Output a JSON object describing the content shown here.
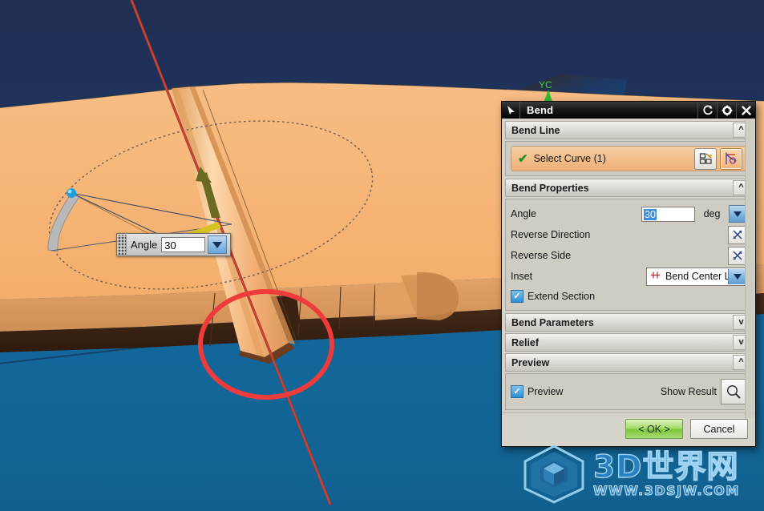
{
  "viewport": {
    "name": "3d-modeling-viewport",
    "background_top_color": "#1e2a4d",
    "background_bottom_color": "#14679c",
    "part_color": "#f5b473",
    "bend_line_color": "#c0392b",
    "annotation_circle_color": "#ee3b3b",
    "triad_label": "YC",
    "triad_label_color": "#2fc02f"
  },
  "angle_float": {
    "label": "Angle",
    "value": "30",
    "placeholder": "30",
    "spin_icon": "chevron-down-icon",
    "grip_icon": "drag-handle-icon"
  },
  "dialog": {
    "title": "Bend",
    "titlebar_icons": {
      "cursor": "cursor-arrow-icon",
      "reset": "reset-arrow-icon",
      "settings": "gear-icon",
      "close": "close-x-icon"
    },
    "sections": [
      {
        "label": "Bend Line",
        "state": "expanded",
        "chevron": "^"
      },
      {
        "label": "Bend Properties",
        "state": "expanded",
        "chevron": "^"
      },
      {
        "label": "Bend Parameters",
        "state": "collapsed",
        "chevron": "v"
      },
      {
        "label": "Relief",
        "state": "collapsed",
        "chevron": "v"
      },
      {
        "label": "Preview",
        "state": "expanded",
        "chevron": "^"
      }
    ],
    "bend_line": {
      "select_curve_label": "Select Curve (1)",
      "status_icon": "green-check-icon",
      "buttons": [
        {
          "icon": "curve-rule-icon",
          "active": false
        },
        {
          "icon": "sketch-curve-icon",
          "active": true
        }
      ]
    },
    "bend_properties": {
      "angle": {
        "label": "Angle",
        "value": "30",
        "unit": "deg",
        "selected": true,
        "dropdown_icon": "chevron-down-icon"
      },
      "reverse_direction": {
        "label": "Reverse Direction",
        "icon": "reverse-arrows-icon"
      },
      "reverse_side": {
        "label": "Reverse Side",
        "icon": "reverse-arrows-icon"
      },
      "inset": {
        "label": "Inset",
        "value": "Bend Center L",
        "icon": "bend-center-line-icon",
        "dropdown_icon": "chevron-down-icon"
      },
      "extend_section": {
        "label": "Extend Section",
        "checked": true
      }
    },
    "preview": {
      "checkbox_label": "Preview",
      "checked": true,
      "show_result_label": "Show Result",
      "show_result_icon": "magnifier-icon"
    },
    "footer": {
      "ok_label": "< OK >",
      "cancel_label": "Cancel"
    }
  },
  "watermark": {
    "logo_icon": "cube-hexagon-logo-icon",
    "site_name": "3D世界网",
    "url": "WWW.3DSJW.COM"
  }
}
